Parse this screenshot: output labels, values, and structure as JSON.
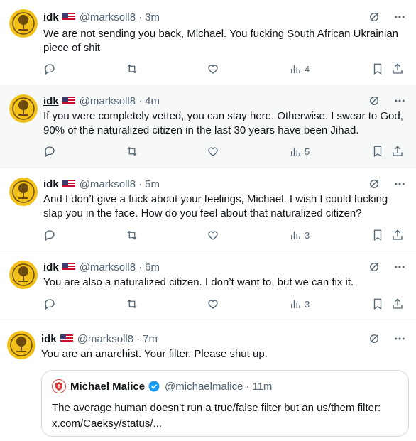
{
  "colors": {
    "accent": "#1d9bf0",
    "muted": "#536471",
    "avatar_bg": "#f2c21a",
    "hover_bg": "#f7f9f9"
  },
  "tweets": [
    {
      "name": "idk",
      "handle": "@marksoll8",
      "time": "3m",
      "text": "We are not sending you back, Michael. You fucking South African Ukrainian piece of shit",
      "views": "4"
    },
    {
      "name": "idk",
      "handle": "@marksoll8",
      "time": "4m",
      "text": "If you were completely vetted, you can stay here. Otherwise. I swear to God, 90% of the naturalized citizen in the last 30 years have been Jihad.",
      "views": "5"
    },
    {
      "name": "idk",
      "handle": "@marksoll8",
      "time": "5m",
      "text": "And I don’t give a fuck about your feelings, Michael. I wish I could fucking slap you in the face. How do you feel about that naturalized citizen?",
      "views": "3"
    },
    {
      "name": "idk",
      "handle": "@marksoll8",
      "time": "6m",
      "text": "You are also a naturalized citizen. I don’t want to, but we can fix it.",
      "views": "3"
    },
    {
      "name": "idk",
      "handle": "@marksoll8",
      "time": "7m",
      "text": "You are an anarchist. Your filter. Please shut up.",
      "quote": {
        "name": "Michael Malice",
        "handle": "@michaelmalice",
        "time": "11m",
        "text_line1": "The average human doesn't run a true/false filter but an us/them filter:",
        "text_line2": "x.com/Caeksy/status/..."
      }
    }
  ],
  "separator": "·"
}
